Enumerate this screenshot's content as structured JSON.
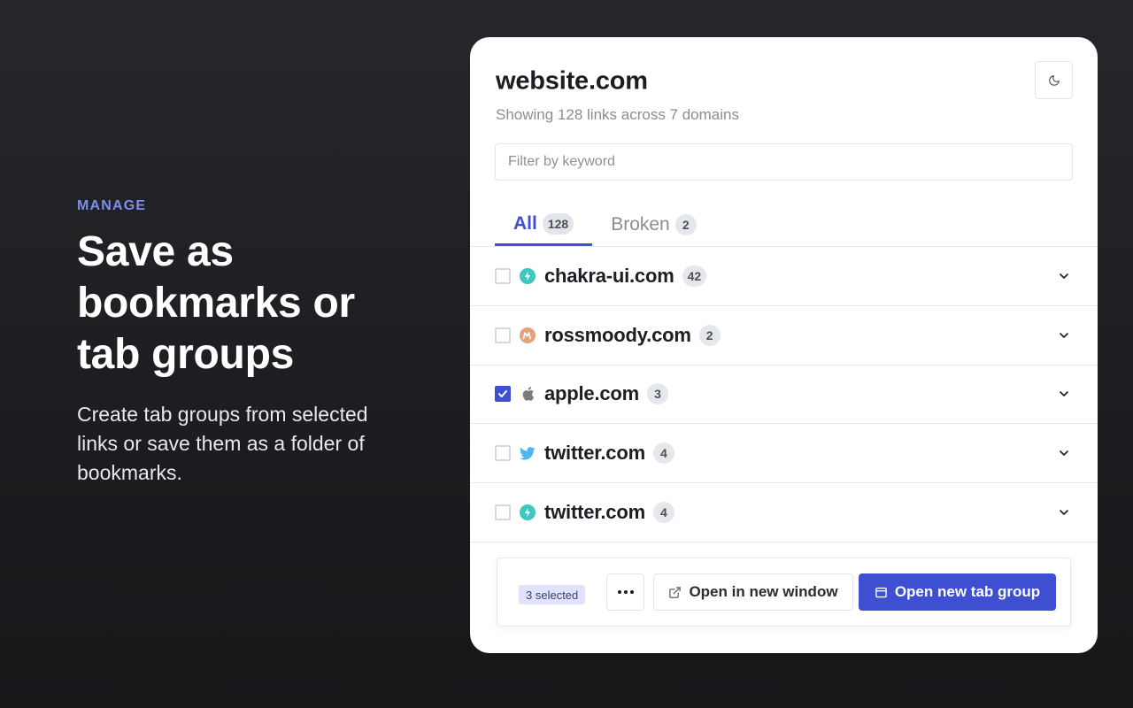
{
  "promo": {
    "eyebrow": "MANAGE",
    "headline": "Save as bookmarks or tab groups",
    "subtitle": "Create tab groups from selected links or save them as a folder of bookmarks."
  },
  "panel": {
    "title": "website.com",
    "subtitle": "Showing 128 links across 7 domains",
    "theme_icon": "moon-icon",
    "filter": {
      "placeholder": "Filter by keyword",
      "value": ""
    },
    "tabs": [
      {
        "label": "All",
        "count": "128",
        "active": true
      },
      {
        "label": "Broken",
        "count": "2",
        "active": false
      }
    ],
    "domains": [
      {
        "name": "chakra-ui.com",
        "count": "42",
        "checked": false,
        "icon": "chakra-icon"
      },
      {
        "name": "rossmoody.com",
        "count": "2",
        "checked": false,
        "icon": "rossmoody-icon"
      },
      {
        "name": "apple.com",
        "count": "3",
        "checked": true,
        "icon": "apple-icon"
      },
      {
        "name": "twitter.com",
        "count": "4",
        "checked": false,
        "icon": "twitter-icon"
      },
      {
        "name": "twitter.com",
        "count": "4",
        "checked": false,
        "icon": "chakra-icon"
      }
    ],
    "actions": {
      "selected": "3 selected",
      "more_icon": "ellipsis-icon",
      "open_window": "Open in new window",
      "open_group": "Open new tab group"
    }
  },
  "colors": {
    "accent": "#3f4fd1",
    "eyebrow": "#7f8cf0",
    "chakra": "#3ec7c0",
    "rossmoody": "#e3a37a",
    "twitter": "#4fb7f0"
  }
}
